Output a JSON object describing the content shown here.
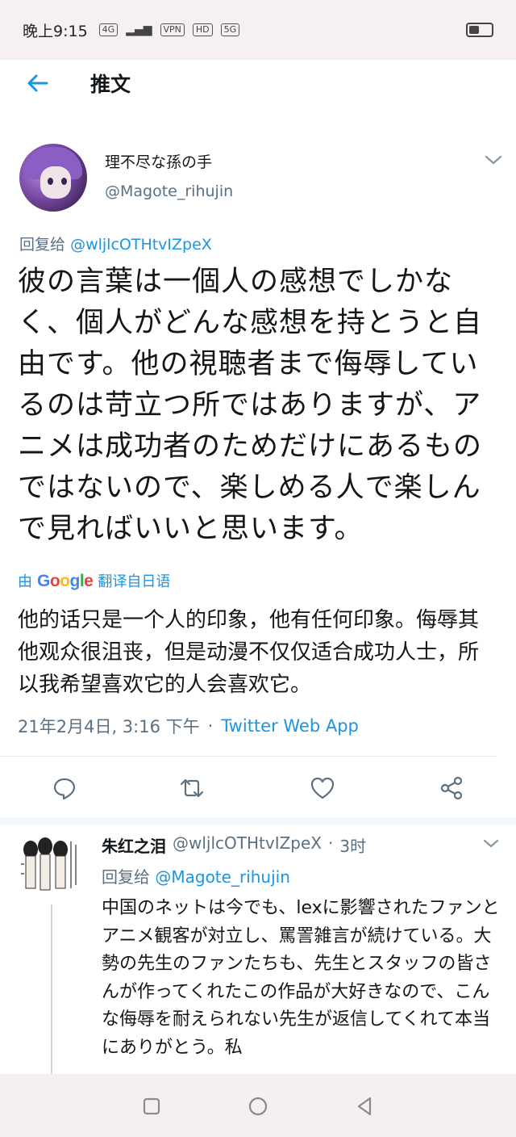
{
  "status_bar": {
    "time": "晚上9:15",
    "icons": [
      "4G",
      "VPN",
      "HD",
      "5G"
    ],
    "battery_level": 0.55
  },
  "header": {
    "title": "推文",
    "back_icon": "arrow-left-icon"
  },
  "tweet": {
    "display_name": "理不尽な孫の手",
    "handle": "@Magote_rihujin",
    "reply_prefix": "回复给",
    "reply_target": "@wljlcOTHtvIZpeX",
    "body": "彼の言葉は一個人の感想でしかなく、個人がどんな感想を持とうと自由です。他の視聴者まで侮辱しているのは苛立つ所ではありますが、アニメは成功者のためだけにあるものではないので、楽しめる人で楽しんで見ればいいと思います。",
    "translate_by": "由",
    "translate_brand": "Google",
    "translate_label": "翻译自日语",
    "translation": "他的话只是一个人的印象，他有任何印象。侮辱其他观众很沮丧，但是动漫不仅仅适合成功人士，所以我希望喜欢它的人会喜欢它。",
    "timestamp": "21年2月4日, 3:16 下午",
    "separator": "·",
    "source_app": "Twitter Web App"
  },
  "actions": [
    "reply-icon",
    "retweet-icon",
    "like-icon",
    "share-icon"
  ],
  "reply": {
    "display_name": "朱红之泪",
    "handle": "@wljlcOTHtvIZpeX",
    "separator": "·",
    "time_ago": "3时",
    "reply_prefix": "回复给",
    "reply_target": "@Magote_rihujin",
    "body": "中国のネットは今でも、lexに影響されたファンとアニメ観客が対立し、罵詈雑言が続けている。大勢の先生のファンたちも、先生とスタッフの皆さんが作ってくれたこの作品が大好きなので、こんな侮辱を耐えられない先生が返信してくれて本当にありがとう。私"
  },
  "nav_bar": {
    "icons": [
      "recents-square-icon",
      "home-circle-icon",
      "back-triangle-icon"
    ]
  },
  "colors": {
    "accent": "#1b95e0",
    "text": "#14171a",
    "muted": "#5b7083"
  }
}
